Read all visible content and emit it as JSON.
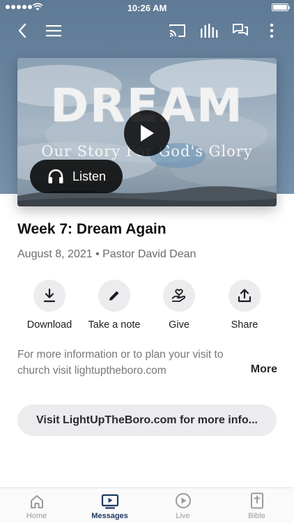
{
  "status_bar": {
    "time": "10:26 AM"
  },
  "hero": {
    "artwork_title": "DREAM",
    "artwork_subtitle": "Our Story For God's Glory",
    "listen_label": "Listen"
  },
  "sermon": {
    "title": "Week 7: Dream Again",
    "meta": "August 8, 2021 • Pastor David Dean"
  },
  "actions": [
    {
      "label": "Download",
      "icon": "download-icon"
    },
    {
      "label": "Take a note",
      "icon": "pencil-icon"
    },
    {
      "label": "Give",
      "icon": "give-hand-heart-icon"
    },
    {
      "label": "Share",
      "icon": "share-icon"
    }
  ],
  "description": {
    "text": "For more information or to plan your visit to church visit lightuptheboro.com",
    "more_label": "More"
  },
  "visit_button": {
    "label": "Visit LightUpTheBoro.com for more info..."
  },
  "tab_bar": {
    "tabs": [
      {
        "label": "Home",
        "icon": "home-icon",
        "active": false
      },
      {
        "label": "Messages",
        "icon": "tv-play-icon",
        "active": true
      },
      {
        "label": "Live",
        "icon": "play-circle-icon",
        "active": false
      },
      {
        "label": "Bible",
        "icon": "bible-icon",
        "active": false
      }
    ]
  },
  "colors": {
    "header_bg": "#6c87a2",
    "active_tab": "#1f3a63",
    "button_bg": "#ececee"
  }
}
